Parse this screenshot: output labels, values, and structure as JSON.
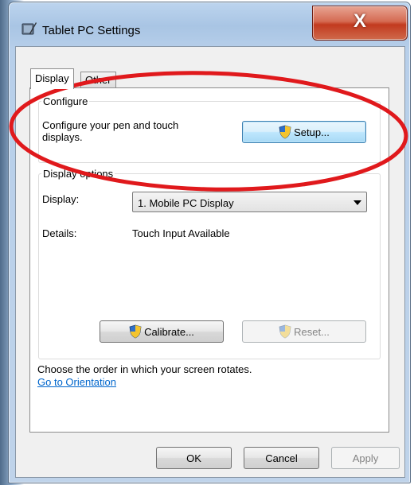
{
  "window": {
    "title": "Tablet PC Settings",
    "close_label": "X"
  },
  "tabs": [
    {
      "label": "Display",
      "selected": true
    },
    {
      "label": "Other",
      "selected": false
    }
  ],
  "configure": {
    "legend": "Configure",
    "description_line1": "Configure your pen and touch",
    "description_line2": "displays.",
    "setup_button": "Setup..."
  },
  "display_options": {
    "legend": "Display options",
    "display_label": "Display:",
    "display_value": "1. Mobile PC Display",
    "details_label": "Details:",
    "details_value": "Touch Input Available",
    "calibrate_button": "Calibrate...",
    "reset_button": "Reset..."
  },
  "orientation": {
    "text": "Choose the order in which your screen rotates.",
    "link": "Go to Orientation"
  },
  "footer": {
    "ok": "OK",
    "cancel": "Cancel",
    "apply": "Apply"
  },
  "colors": {
    "annotation_ellipse": "#e0191c",
    "link": "#0066cc",
    "close_button": "#c23a1f"
  },
  "icons": [
    "tablet-pen-icon",
    "uac-shield-icon",
    "chevron-down-icon"
  ]
}
